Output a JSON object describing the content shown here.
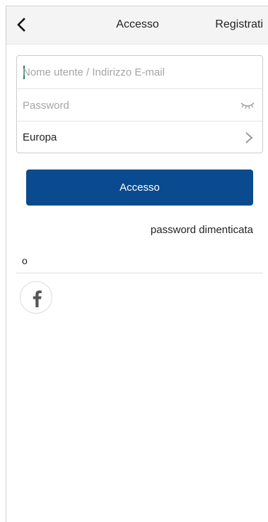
{
  "header": {
    "title": "Accesso",
    "register_label": "Registrati"
  },
  "form": {
    "username_placeholder": "Nome utente / Indirizzo E-mail",
    "password_placeholder": "Password",
    "region_value": "Europa"
  },
  "actions": {
    "login_label": "Accesso",
    "forgot_password_label": "password dimenticata"
  },
  "social": {
    "or_label": "o",
    "providers": [
      "facebook"
    ]
  },
  "icons": {
    "back": "chevron-left-icon",
    "password_toggle": "closed-eye-icon",
    "region_chevron": "chevron-right-icon",
    "facebook": "facebook-icon"
  },
  "colors": {
    "primary": "#0a4a8e",
    "caret": "#2a7a6a"
  }
}
